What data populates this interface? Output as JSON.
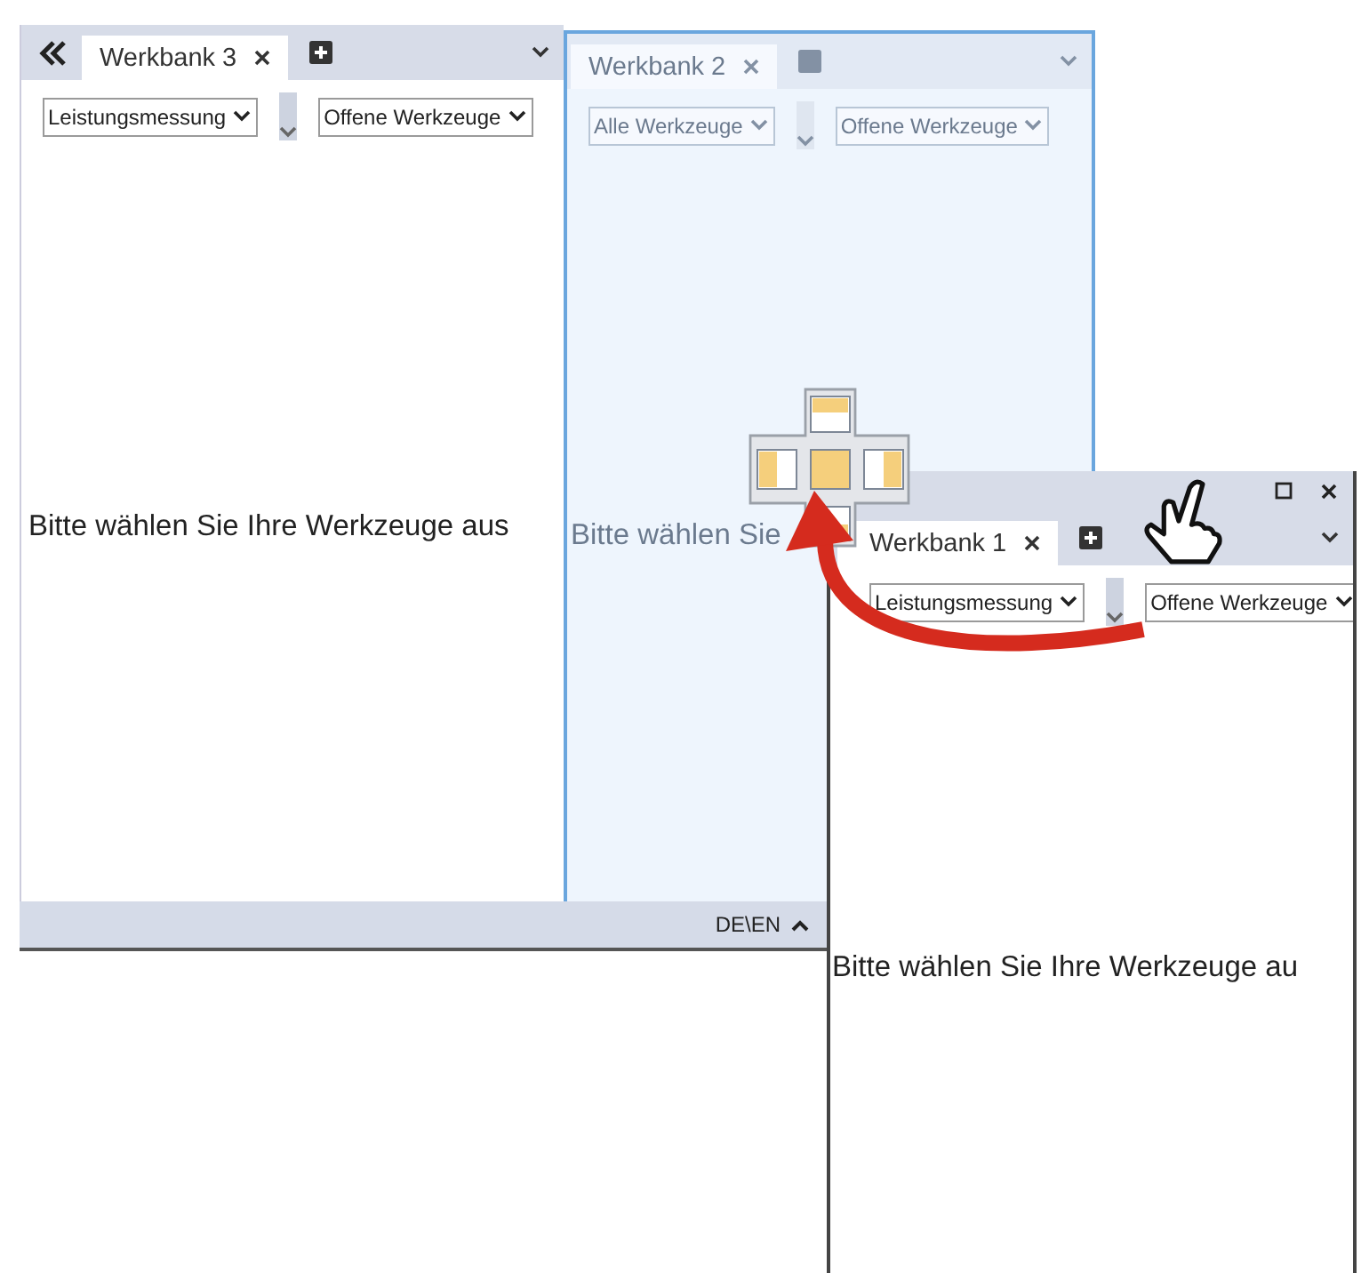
{
  "main_window": {
    "panes": [
      {
        "collapse_icon": true,
        "drop_preview": false,
        "tab": {
          "label": "Werkbank 3",
          "selected": true
        },
        "filters": [
          "Leistungsmessung",
          "Offene Werkzeuge"
        ],
        "message": "Bitte wählen Sie Ihre Werkzeuge aus"
      },
      {
        "collapse_icon": false,
        "drop_preview": true,
        "tab": {
          "label": "Werkbank 2",
          "selected": true
        },
        "filters": [
          "Alle Werkzeuge",
          "Offene Werkzeuge"
        ],
        "message": "Bitte wählen Sie"
      }
    ],
    "status_bar": {
      "language": "DE\\EN"
    }
  },
  "floating_window": {
    "pane": {
      "collapse_icon": false,
      "drop_preview": false,
      "tab": {
        "label": "Werkbank 1",
        "selected": true
      },
      "filters": [
        "Leistungsmessung",
        "Offene Werkzeuge"
      ],
      "message": "Bitte wählen Sie Ihre Werkzeuge au"
    }
  }
}
